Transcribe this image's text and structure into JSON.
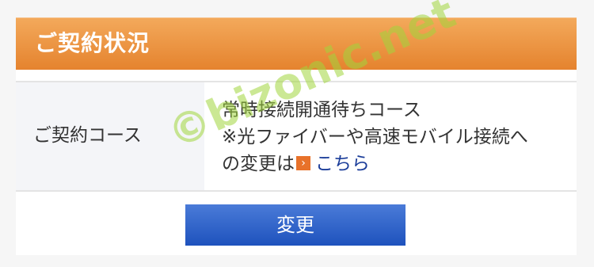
{
  "header": {
    "title": "ご契約状況"
  },
  "contract": {
    "label": "ご契約コース",
    "line1": "常時接続開通待ちコース",
    "line2": "※光ファイバーや高速モバイル接続へ",
    "line3_prefix": "の変更は",
    "link_label": "こちら",
    "link_icon": "arrow-right-icon"
  },
  "button": {
    "label": "変更"
  },
  "watermark": {
    "text": "©bizonic.net"
  },
  "colors": {
    "header_top": "#f3a95b",
    "header_bottom": "#e5832e",
    "button_top": "#4a7bd8",
    "button_bottom": "#1e52bd",
    "link": "#1a3c99"
  }
}
